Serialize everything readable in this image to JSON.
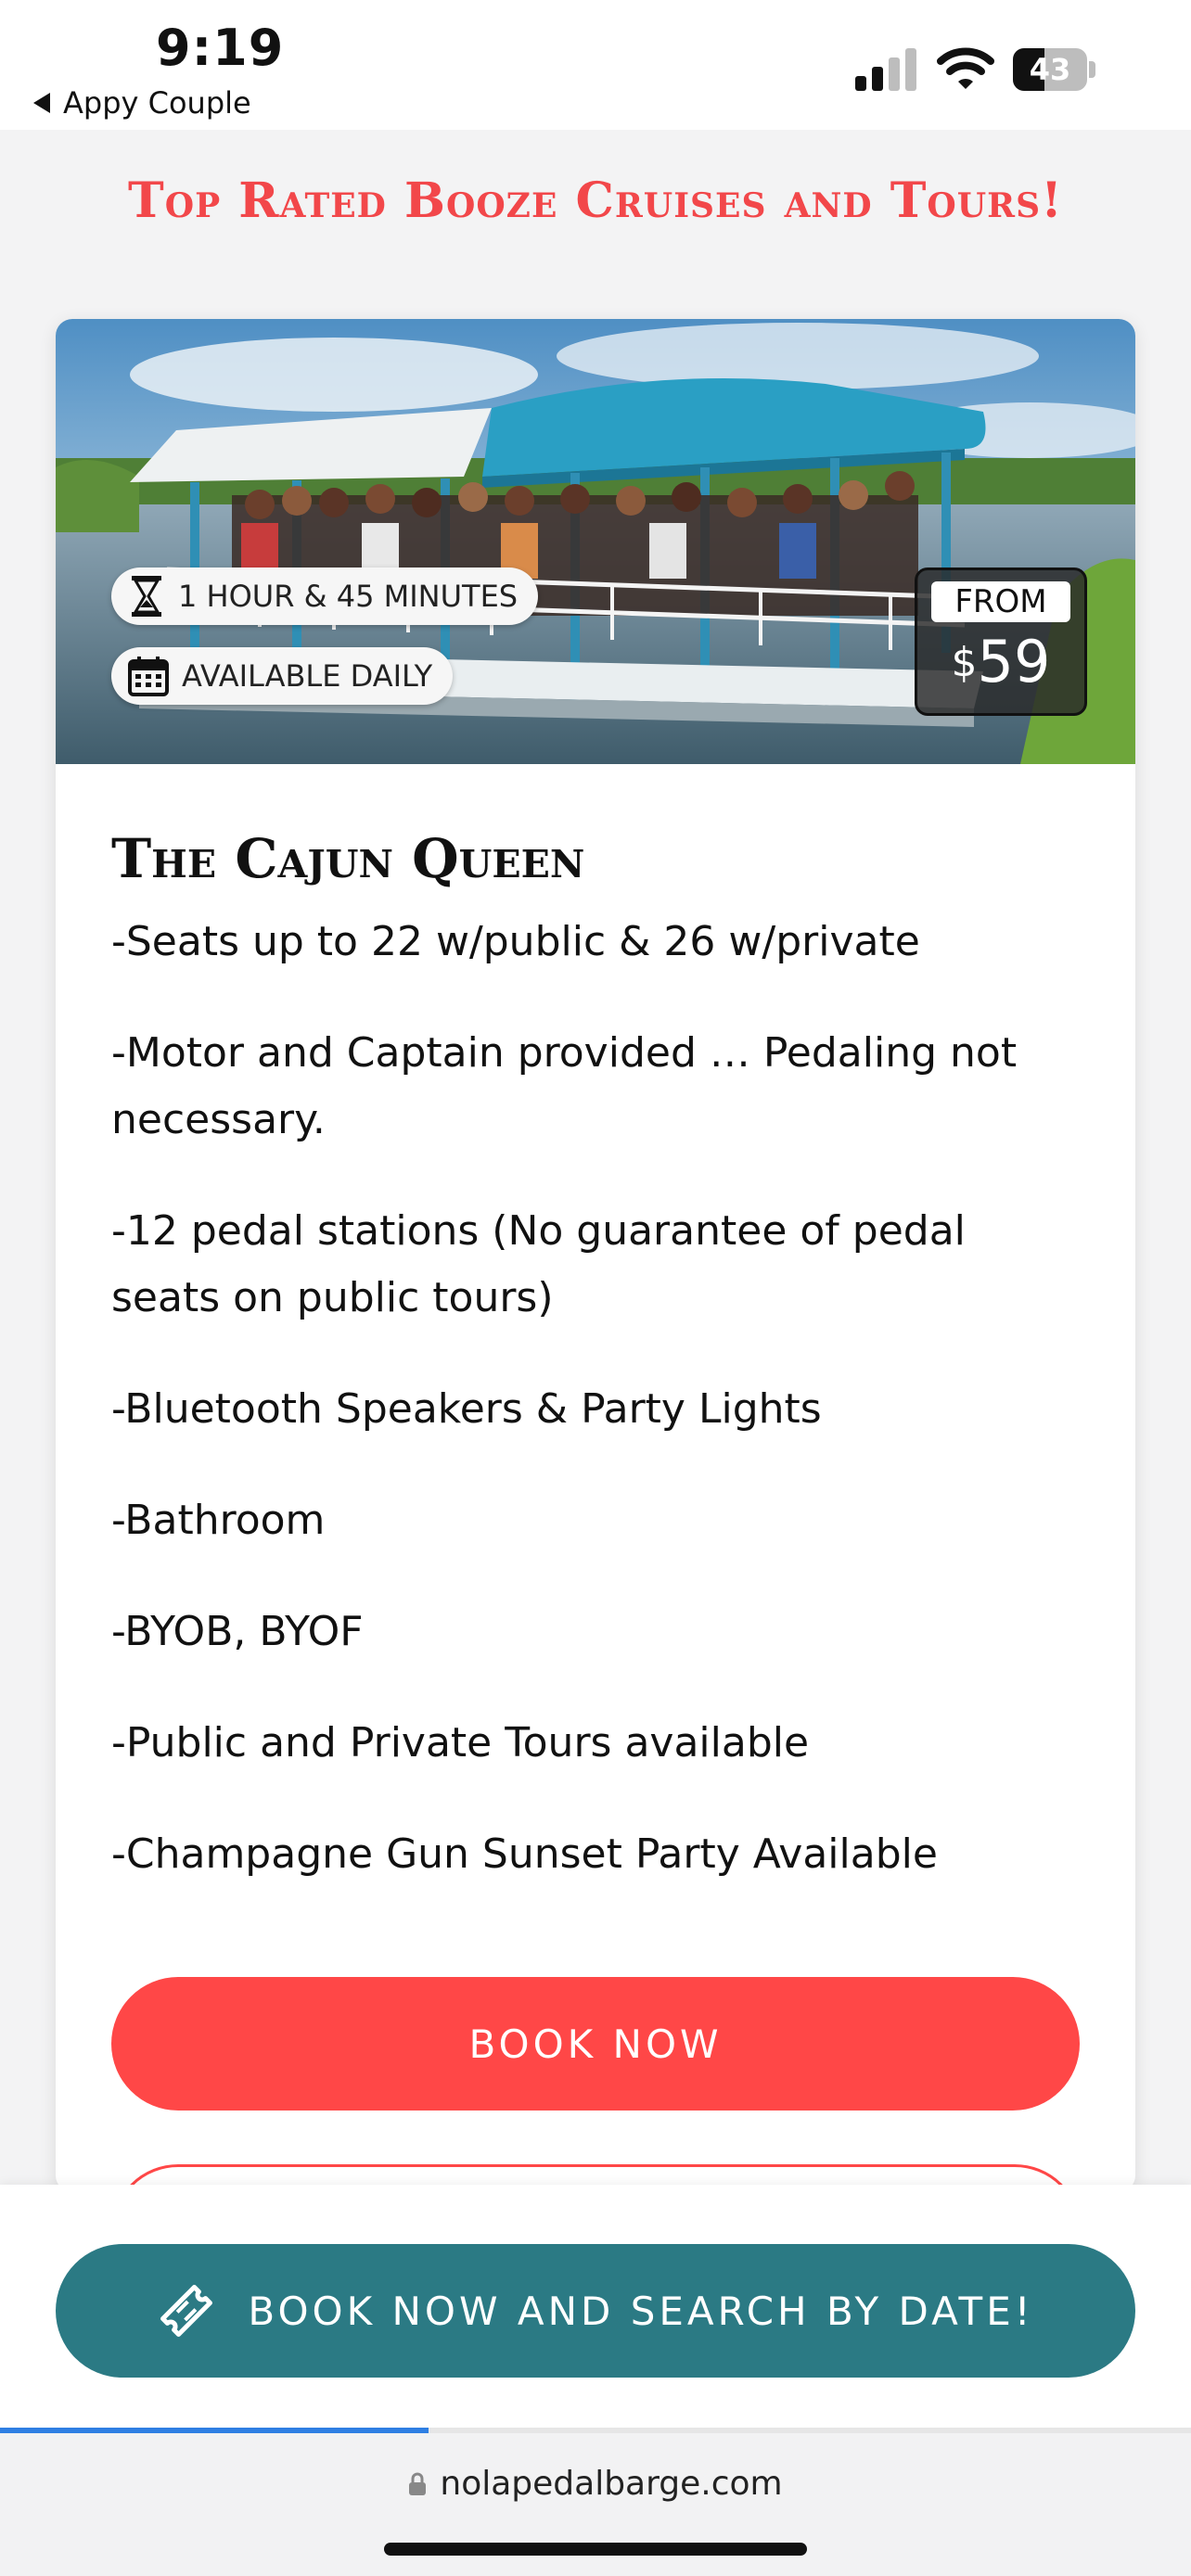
{
  "status_bar": {
    "time": "9:19",
    "back_label": "Appy Couple",
    "battery_level": "43",
    "battery_fraction": 0.43
  },
  "page": {
    "heading": "Top Rated Booze Cruises and Tours!",
    "accent_color": "#f2474a"
  },
  "card": {
    "duration": "1 HOUR & 45 MINUTES",
    "availability": "AVAILABLE DAILY",
    "price_from_label": "FROM",
    "price_currency": "$",
    "price_amount": "59",
    "title": "The Cajun Queen",
    "features": [
      "-Seats up to 22 w/public & 26 w/private",
      "-Motor and Captain provided … Pedaling not necessary.",
      "-12 pedal stations (No guarantee of pedal seats on public tours)",
      "-Bluetooth Speakers & Party Lights",
      "-Bathroom",
      "-BYOB, BYOF",
      "-Public and Private Tours available",
      "-Champagne Gun Sunset Party Available"
    ],
    "book_now_label": "BOOK NOW",
    "book_now_color": "#ff4747"
  },
  "sticky_bar": {
    "search_label": "BOOK NOW AND SEARCH BY DATE!",
    "button_color": "#2b7a84",
    "icon": "ticket-icon"
  },
  "browser": {
    "url": "nolapedalbarge.com",
    "load_progress": 0.36
  }
}
